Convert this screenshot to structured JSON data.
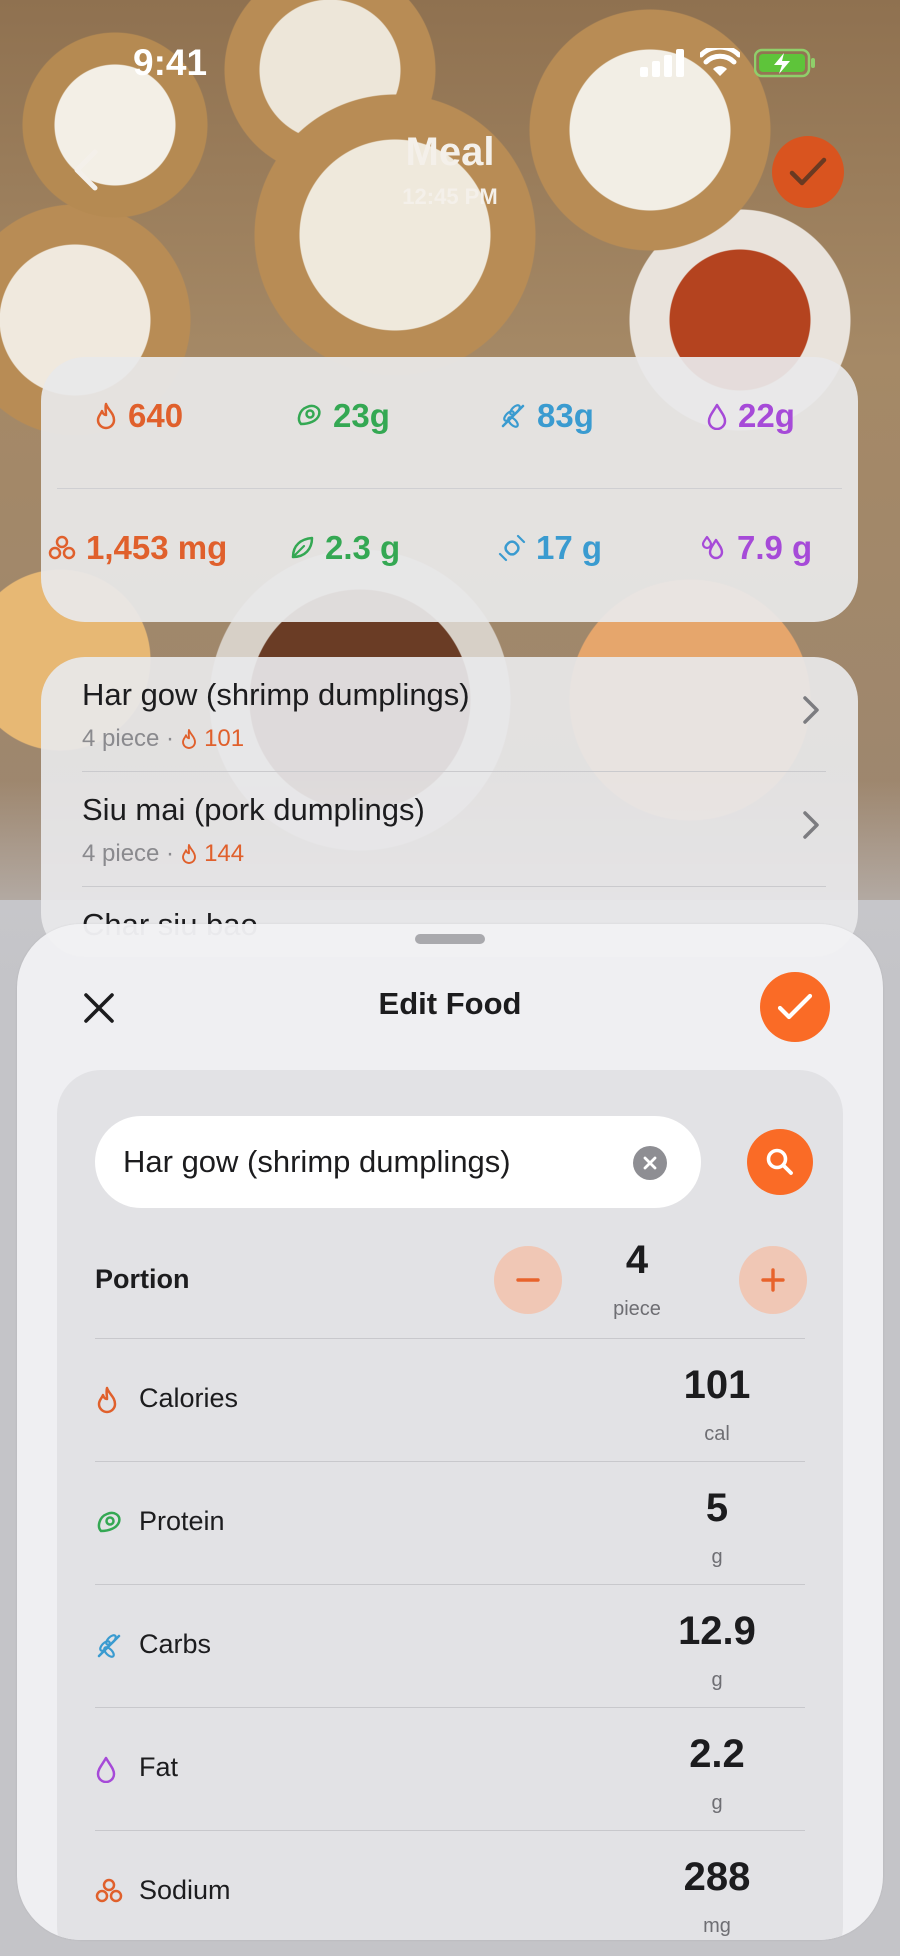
{
  "status_bar": {
    "time": "9:41"
  },
  "header": {
    "title": "Meal",
    "time": "12:45 PM"
  },
  "colors": {
    "calories": "#e0602c",
    "protein": "#34a853",
    "carbs": "#3a9bd0",
    "fat": "#a64ad8",
    "accent": "#fa6b26"
  },
  "summary": {
    "row1": [
      {
        "icon": "flame-icon",
        "value": "640"
      },
      {
        "icon": "meat-icon",
        "value": "23g"
      },
      {
        "icon": "wheat-icon",
        "value": "83g"
      },
      {
        "icon": "drop-icon",
        "value": "22g"
      }
    ],
    "row2": [
      {
        "icon": "molecule-icon",
        "value": "1,453 mg"
      },
      {
        "icon": "leaf-icon",
        "value": "2.3 g"
      },
      {
        "icon": "candy-icon",
        "value": "17 g"
      },
      {
        "icon": "drops-icon",
        "value": "7.9 g"
      }
    ]
  },
  "food_list": [
    {
      "name": "Har gow (shrimp dumplings)",
      "portion": "4 piece ·",
      "calories": "101"
    },
    {
      "name": "Siu mai (pork dumplings)",
      "portion": "4 piece ·",
      "calories": "144"
    },
    {
      "name": "Char siu bao",
      "portion": "",
      "calories": ""
    }
  ],
  "sheet": {
    "title": "Edit Food",
    "search_value": "Har gow (shrimp dumplings)",
    "portion_label": "Portion",
    "portion_value": "4",
    "portion_unit": "piece",
    "nutrients": [
      {
        "label": "Calories",
        "value": "101",
        "unit": "cal",
        "icon": "flame-icon"
      },
      {
        "label": "Protein",
        "value": "5",
        "unit": "g",
        "icon": "meat-icon"
      },
      {
        "label": "Carbs",
        "value": "12.9",
        "unit": "g",
        "icon": "wheat-icon"
      },
      {
        "label": "Fat",
        "value": "2.2",
        "unit": "g",
        "icon": "drop-icon"
      },
      {
        "label": "Sodium",
        "value": "288",
        "unit": "mg",
        "icon": "molecule-icon"
      }
    ]
  }
}
